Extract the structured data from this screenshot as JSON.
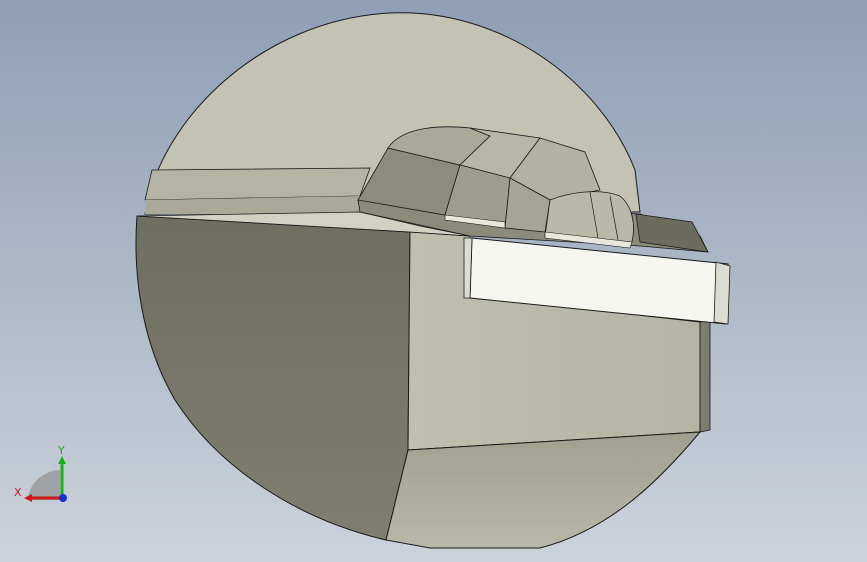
{
  "viewport": {
    "background_top": "#8fa0b8",
    "background_bottom": "#c9d0d8"
  },
  "model": {
    "disc_face_light": "#c2c1b2",
    "disc_face_mid": "#b3b2a3",
    "shadow_face": "#7c7b6c",
    "body_face": "#bcbbab",
    "lower_face": "#a8a798",
    "slot_face": "#f4f4ee",
    "edge_color": "#1a1a1a"
  },
  "triad": {
    "x_label": "X",
    "y_label": "Y",
    "x_color": "#d01818",
    "y_color": "#18b018",
    "z_color": "#1830d0"
  }
}
